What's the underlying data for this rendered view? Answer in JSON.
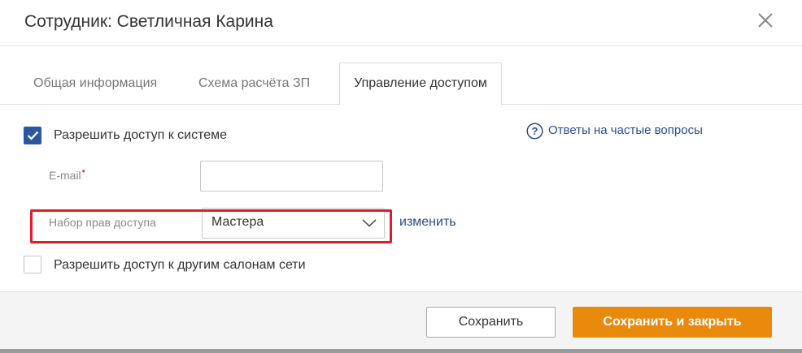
{
  "dialog": {
    "title": "Сотрудник: Светличная Карина",
    "close_icon": "close-icon"
  },
  "tabs": [
    {
      "label": "Общая информация",
      "active": false
    },
    {
      "label": "Схема расчёта ЗП",
      "active": false
    },
    {
      "label": "Управление доступом",
      "active": true
    }
  ],
  "access": {
    "allow_system_label": "Разрешить доступ к системе",
    "allow_system_checked": true,
    "email_label": "E-mail",
    "email_required_mark": "•",
    "email_value": "",
    "rights_label": "Набор прав доступа",
    "rights_value": "Мастера",
    "change_link": "изменить",
    "allow_other_salons_label": "Разрешить доступ к другим салонам сети",
    "allow_other_salons_checked": false
  },
  "faq": {
    "icon": "question-circle-icon",
    "label": "Ответы на частые вопросы"
  },
  "footer": {
    "save_label": "Сохранить",
    "save_close_label": "Сохранить и закрыть"
  },
  "colors": {
    "accent_blue": "#2b57a0",
    "link_blue": "#2b4c8c",
    "primary_orange": "#ea8a0c",
    "highlight_red": "#e21c24"
  }
}
